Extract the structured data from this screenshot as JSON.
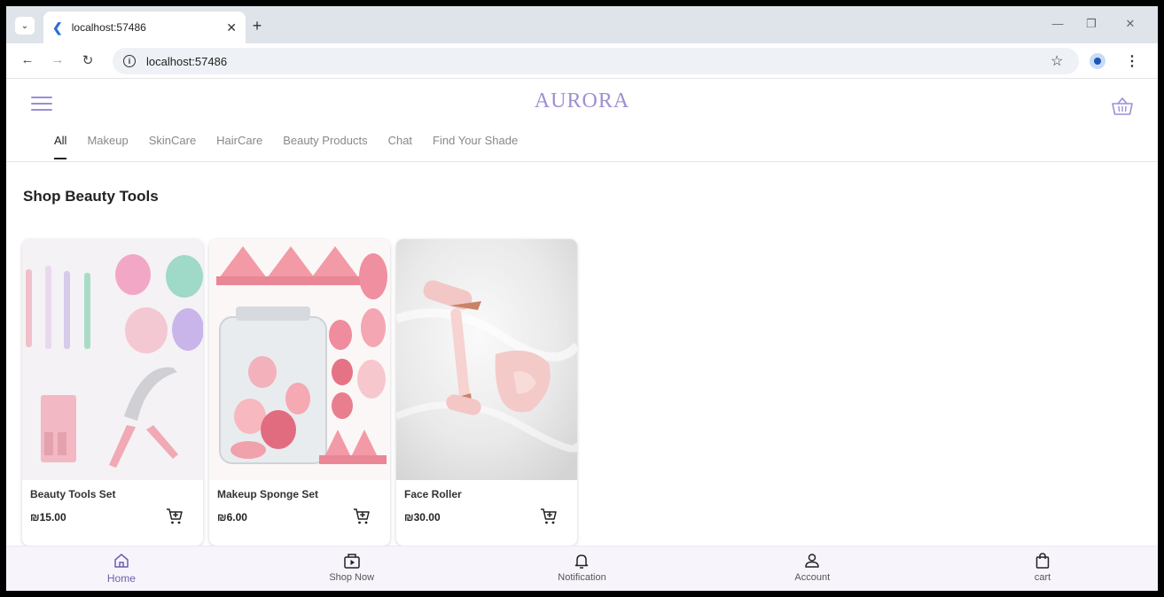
{
  "browser": {
    "tab_title": "localhost:57486",
    "url": "localhost:57486"
  },
  "app": {
    "brand": "AURORA",
    "categories": [
      "All",
      "Makeup",
      "SkinCare",
      "HairCare",
      "Beauty Products",
      "Chat",
      "Find Your Shade"
    ],
    "active_category": "All",
    "section_title": "Shop Beauty Tools",
    "products": [
      {
        "name": "Beauty Tools Set",
        "price": "₪15.00"
      },
      {
        "name": "Makeup Sponge Set",
        "price": "₪6.00"
      },
      {
        "name": "Face Roller",
        "price": "₪30.00"
      }
    ],
    "bottom_nav": [
      {
        "label": "Home",
        "icon": "home-icon",
        "active": true
      },
      {
        "label": "Shop Now",
        "icon": "shop-now-icon",
        "active": false
      },
      {
        "label": "Notification",
        "icon": "bell-icon",
        "active": false
      },
      {
        "label": "Account",
        "icon": "person-icon",
        "active": false
      },
      {
        "label": "cart",
        "icon": "shopping-bag-icon",
        "active": false
      }
    ]
  },
  "colors": {
    "accent": "#9f8fd2",
    "nav_active": "#6b5fb0"
  }
}
